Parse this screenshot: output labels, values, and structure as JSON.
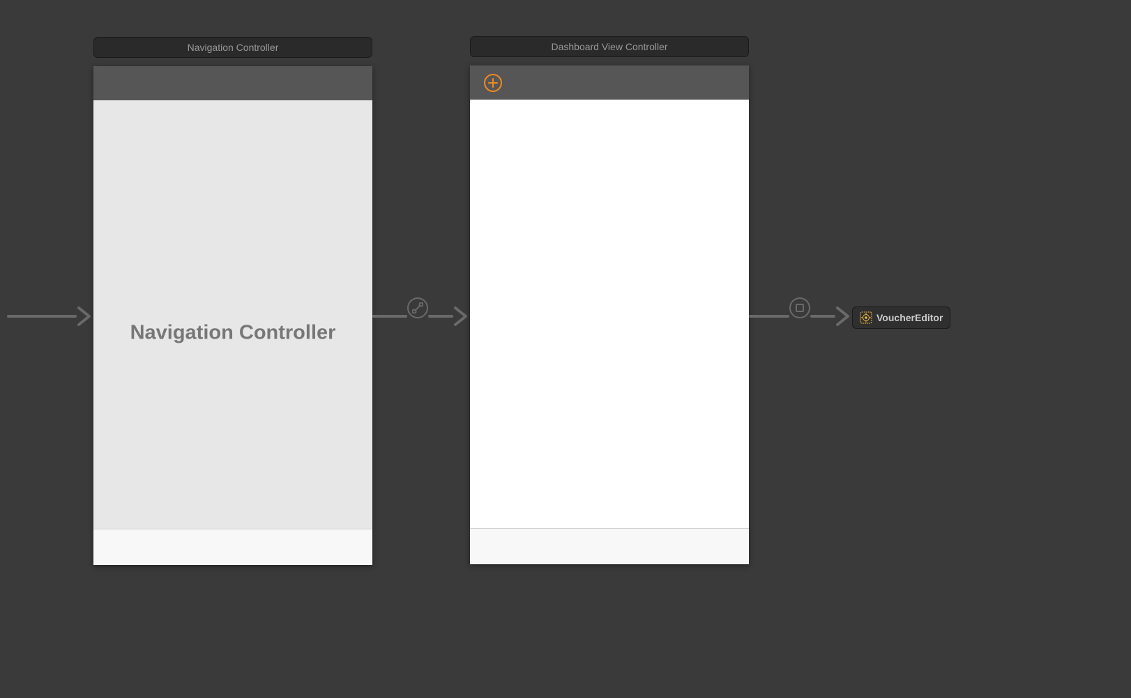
{
  "scenes": {
    "nav": {
      "title": "Navigation Controller",
      "placeholder": "Navigation Controller"
    },
    "dashboard": {
      "title": "Dashboard View Controller"
    }
  },
  "storyboard_reference": {
    "label": "VoucherEditor"
  },
  "icons": {
    "add": "plus-circle-icon",
    "segue_root": "relationship-segue-icon",
    "segue_modal": "present-modally-segue-icon"
  },
  "colors": {
    "accent": "#ef8a1f",
    "canvas_bg": "#3a3a3a"
  }
}
